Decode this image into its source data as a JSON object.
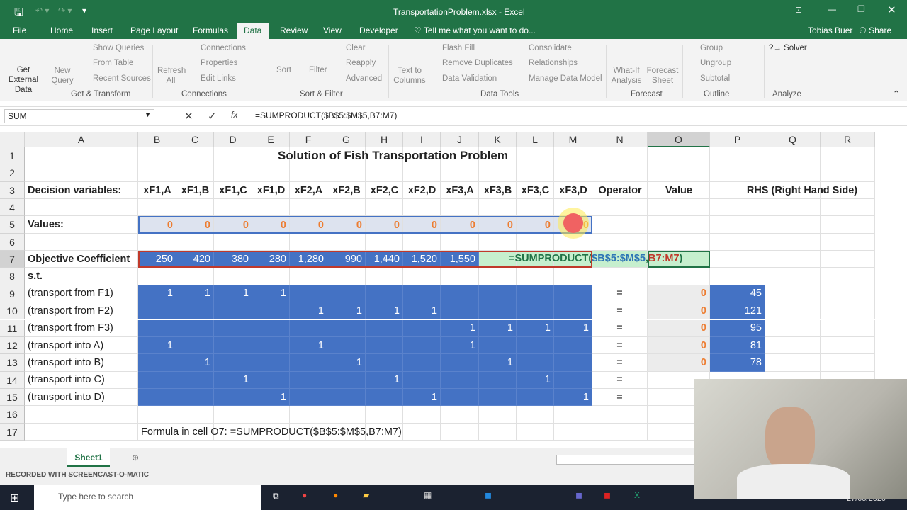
{
  "window": {
    "title": "TransportationProblem.xlsx - Excel",
    "user": "Tobias Buer",
    "share": "Share"
  },
  "tabs": [
    "File",
    "Home",
    "Insert",
    "Page Layout",
    "Formulas",
    "Data",
    "Review",
    "View",
    "Developer"
  ],
  "tell_me": "Tell me what you want to do...",
  "ribbon": {
    "get_external": "Get External Data",
    "new_query": "New Query",
    "show_queries": "Show Queries",
    "from_table": "From Table",
    "recent_sources": "Recent Sources",
    "grp_get": "Get & Transform",
    "refresh": "Refresh All",
    "connections": "Connections",
    "properties": "Properties",
    "edit_links": "Edit Links",
    "grp_conn": "Connections",
    "sort": "Sort",
    "filter": "Filter",
    "clear": "Clear",
    "reapply": "Reapply",
    "advanced": "Advanced",
    "grp_sort": "Sort & Filter",
    "text_to_columns": "Text to Columns",
    "flash_fill": "Flash Fill",
    "remove_dup": "Remove Duplicates",
    "data_val": "Data Validation",
    "consolidate": "Consolidate",
    "relationships": "Relationships",
    "manage_model": "Manage Data Model",
    "grp_tools": "Data Tools",
    "what_if": "What-If Analysis",
    "forecast_sheet": "Forecast Sheet",
    "grp_forecast": "Forecast",
    "group": "Group",
    "ungroup": "Ungroup",
    "subtotal": "Subtotal",
    "grp_outline": "Outline",
    "solver": "Solver",
    "grp_analyze": "Analyze"
  },
  "formula_bar": {
    "name_box": "SUM",
    "formula": "=SUMPRODUCT($B$5:$M$5,B7:M7)"
  },
  "columns": [
    "A",
    "B",
    "C",
    "D",
    "E",
    "F",
    "G",
    "H",
    "I",
    "J",
    "K",
    "L",
    "M",
    "N",
    "O",
    "P",
    "Q",
    "R"
  ],
  "sheet": {
    "title": "Solution of Fish Transportation Problem",
    "headers": [
      "Decision variables:",
      "xF1,A",
      "xF1,B",
      "xF1,C",
      "xF1,D",
      "xF2,A",
      "xF2,B",
      "xF2,C",
      "xF2,D",
      "xF3,A",
      "xF3,B",
      "xF3,C",
      "xF3,D",
      "Operator",
      "Value",
      "RHS (Right Hand Side)"
    ],
    "values_label": "Values:",
    "values": [
      "0",
      "0",
      "0",
      "0",
      "0",
      "0",
      "0",
      "0",
      "0",
      "0",
      "0",
      "0"
    ],
    "obj_label": "Objective Coefficient",
    "obj": [
      "250",
      "420",
      "380",
      "280",
      "1,280",
      "990",
      "1,440",
      "1,520",
      "1,550"
    ],
    "edit_formula": [
      "=SUMPRODUCT(",
      "$B$5:$M$5",
      ",",
      "B7:M7",
      ")"
    ],
    "st": "s.t.",
    "constraints": [
      {
        "label": "(transport from F1)",
        "m": [
          "1",
          "1",
          "1",
          "1",
          "",
          "",
          "",
          "",
          "",
          "",
          "",
          ""
        ],
        "op": "=",
        "val": "0",
        "rhs": "45"
      },
      {
        "label": "(transport from F2)",
        "m": [
          "",
          "",
          "",
          "",
          "1",
          "1",
          "1",
          "1",
          "",
          "",
          "",
          ""
        ],
        "op": "=",
        "val": "0",
        "rhs": "121"
      },
      {
        "label": "(transport from F3)",
        "m": [
          "",
          "",
          "",
          "",
          "",
          "",
          "",
          "",
          "1",
          "1",
          "1",
          "1"
        ],
        "op": "=",
        "val": "0",
        "rhs": "95"
      },
      {
        "label": "(transport into A)",
        "m": [
          "1",
          "",
          "",
          "",
          "1",
          "",
          "",
          "",
          "1",
          "",
          "",
          ""
        ],
        "op": "=",
        "val": "0",
        "rhs": "81"
      },
      {
        "label": "(transport into B)",
        "m": [
          "",
          "1",
          "",
          "",
          "",
          "1",
          "",
          "",
          "",
          "1",
          "",
          ""
        ],
        "op": "=",
        "val": "0",
        "rhs": "78"
      },
      {
        "label": "(transport into C)",
        "m": [
          "",
          "",
          "1",
          "",
          "",
          "",
          "1",
          "",
          "",
          "",
          "1",
          ""
        ],
        "op": "=",
        "val": "",
        "rhs": ""
      },
      {
        "label": "(transport into D)",
        "m": [
          "",
          "",
          "",
          "1",
          "",
          "",
          "",
          "1",
          "",
          "",
          "",
          "1"
        ],
        "op": "=",
        "val": "",
        "rhs": ""
      }
    ],
    "note": "Formula in cell O7: =SUMPRODUCT($B$5:$M$5,B7:M7)"
  },
  "sheet_tab": "Sheet1",
  "watermark": "RECORDED WITH SCREENCAST-O-MATIC",
  "taskbar": {
    "search": "Type here to search",
    "date": "27/05/2020"
  },
  "colors": {
    "excel_green": "#217346",
    "cell_blue": "#4472c4",
    "value_orange": "#ed7d31"
  }
}
